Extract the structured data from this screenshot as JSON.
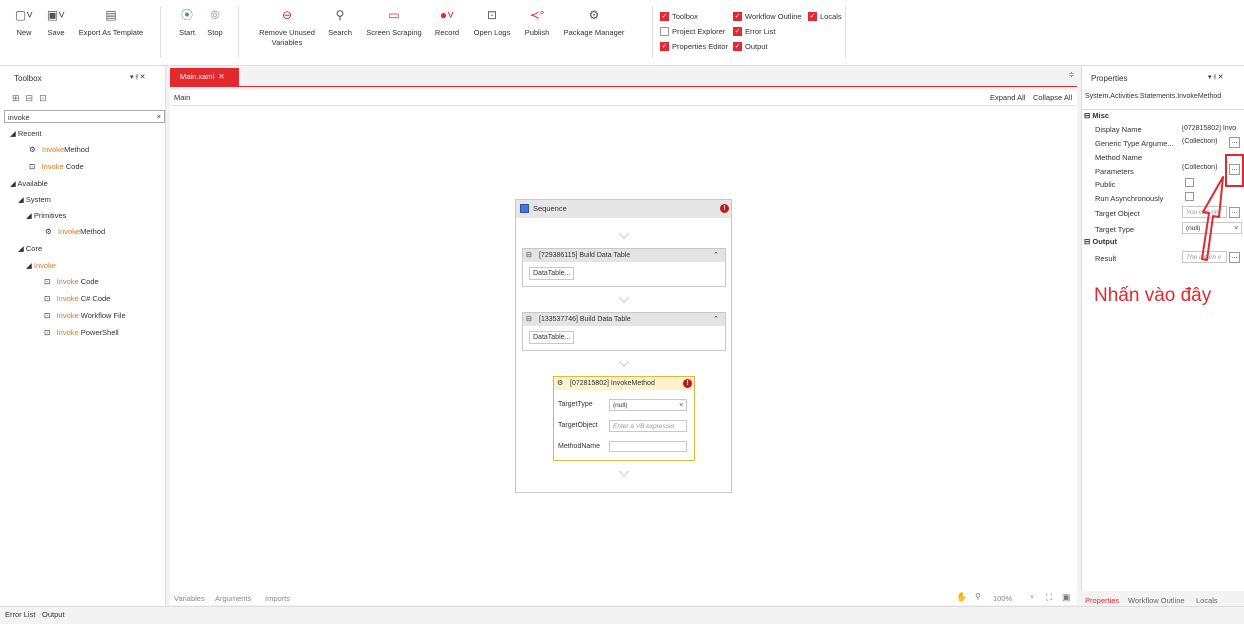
{
  "ribbon": {
    "new": "New",
    "save": "Save",
    "export_template": "Export As Template",
    "start": "Start",
    "stop": "Stop",
    "remove_unused_1": "Remove Unused",
    "remove_unused_2": "Variables",
    "search": "Search",
    "screen_scraping": "Screen Scraping",
    "record": "Record",
    "open_logs": "Open Logs",
    "publish": "Publish",
    "package_manager": "Package Manager",
    "checks": {
      "toolbox": "Toolbox",
      "workflow_outline": "Workflow Outline",
      "locals": "Locals",
      "project_explorer": "Project Explorer",
      "error_list": "Error List",
      "properties_editor": "Properties Editor",
      "output": "Output"
    }
  },
  "toolbox": {
    "title": "Toolbox",
    "search_value": "invoke",
    "recent": "Recent",
    "available": "Available",
    "system": "System",
    "primitives": "Primitives",
    "core": "Core",
    "invoke_hl": "Invoke",
    "method_suffix": "Method",
    "code_suffix": " Code",
    "csharp_suffix": " C# Code",
    "workflow_suffix": " Workflow File",
    "powershell_suffix": " PowerShell"
  },
  "designer": {
    "tab": "Main.xaml",
    "breadcrumb": "Main",
    "expand_all": "Expand All",
    "collapse_all": "Collapse All",
    "sequence": "Sequence",
    "build1": "[729386115] Build Data Table",
    "build2": "[133537746] Build Data Table",
    "datatable_btn": "DataTable...",
    "invoke_title": "[072815802] InvokeMethod",
    "target_type_label": "TargetType",
    "target_type_value": "(null)",
    "target_object_label": "TargetObject",
    "target_object_placeholder": "Enter a VB expressio",
    "method_name_label": "MethodName",
    "bottom_tabs": {
      "variables": "Variables",
      "arguments": "Arguments",
      "imports": "Imports"
    },
    "zoom": "100%"
  },
  "properties": {
    "title": "Properties",
    "type": "System.Activities.Statements.InvokeMethod",
    "misc": "Misc",
    "rows": {
      "display_name": "Display Name",
      "display_name_val": "[072815802] Invo",
      "generic_type": "Generic Type Argume...",
      "generic_type_val": "(Collection)",
      "method_name": "Method Name",
      "parameters": "Parameters",
      "parameters_val": "(Collection)",
      "public": "Public",
      "run_async": "Run Asynchronously",
      "target_object": "Target Object",
      "target_object_val": "You can on",
      "target_type": "Target Type",
      "target_type_val": "(null)"
    },
    "output": "Output",
    "result": "Result",
    "result_val": "The return v",
    "annotation": "Nhấn vào đây",
    "bottom_tabs": {
      "properties": "Properties",
      "workflow_outline": "Workflow Outline",
      "locals": "Locals"
    }
  },
  "status": {
    "error_list": "Error List",
    "output": "Output"
  },
  "colors": {
    "accent": "#e3292f",
    "invoke_highlight": "#e87722"
  }
}
